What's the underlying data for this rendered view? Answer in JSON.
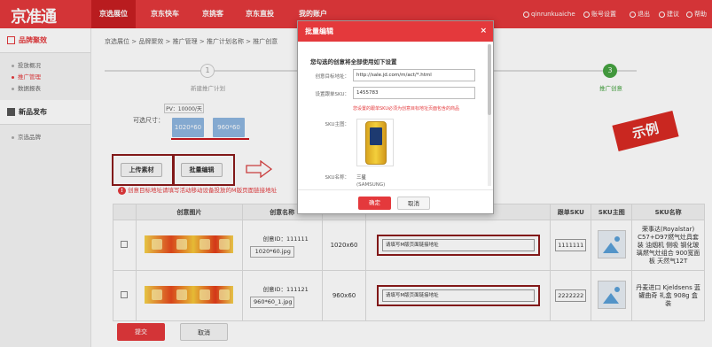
{
  "topnav": {
    "logo": "京准通",
    "tabs": [
      {
        "label": "京选展位",
        "active": true
      },
      {
        "label": "京东快车",
        "active": false
      },
      {
        "label": "京挑客",
        "active": false
      },
      {
        "label": "京东直投",
        "active": false
      },
      {
        "label": "我的账户",
        "active": false
      }
    ],
    "user": "qinrunkuaiche",
    "actions": [
      "账号设置",
      "退出",
      "建议",
      "帮助"
    ]
  },
  "sidebar": {
    "section1": "品牌聚效",
    "items1": [
      {
        "label": "投放概况",
        "active": false
      },
      {
        "label": "推广管理",
        "active": true
      },
      {
        "label": "数据报表",
        "active": false
      }
    ],
    "section2": "新品发布",
    "items2": [
      {
        "label": "京选品牌",
        "active": false
      }
    ]
  },
  "breadcrumb": "京选展位 > 品牌聚效 > 推广管理 > 推广计划名称 > 推广创意",
  "steps": [
    {
      "num": "1",
      "label": "新建推广计划",
      "active": false
    },
    {
      "num": "3",
      "label": "推广创意",
      "active": true
    }
  ],
  "size_selector": {
    "label": "可选尺寸：",
    "tooltip": "PV：10000/天",
    "options": [
      "1020*60",
      "960*60"
    ]
  },
  "buttons": {
    "upload": "上传素材",
    "batch_edit": "批量编辑",
    "submit": "提交",
    "cancel": "取消"
  },
  "warning": "创意目标地址请填写活动移动设备投放的M版页面链接地址",
  "stamp": "示例",
  "table": {
    "headers": [
      "创意图片",
      "创意名称",
      "",
      "",
      "跟单SKU",
      "SKU主图",
      "SKU名称"
    ],
    "rows": [
      {
        "creative_id": "创意ID：111111",
        "creative_name": "1020*60.jpg",
        "size": "1020x60",
        "url_placeholder": "请填写M版页面链接地址",
        "sku": "1111111",
        "sku_name": "荣事达(Royalstar) C57+D97燃气灶具套装 油烟机 侧吸 钢化玻璃燃气灶组合 900宽面板 天然气12T"
      },
      {
        "creative_id": "创意ID：111121",
        "creative_name": "960*60_1.jpg",
        "size": "960x60",
        "url_placeholder": "请填写M版页面链接地址",
        "sku": "2222222",
        "sku_name": "丹麦进口 Kjeldsens 蓝罐曲奇 礼盒 908g 盒装"
      }
    ]
  },
  "modal": {
    "title": "批量编辑",
    "close": "×",
    "intro": "您勾选的创意将全部使用如下设置",
    "url_label": "创意目标地址：",
    "url_value": "http://sale.jd.com/m/act/*.html",
    "sku_label": "设置跟单SKU：",
    "sku_value": "1455783",
    "hint": "您设置的跟单SKU必须为创意目标地址页面包含的商品",
    "image_label": "SKU主图：",
    "name_label": "SKU名称：",
    "name_value_1": "三星",
    "name_value_2": "(SAMSUNG)",
    "ok": "确定",
    "cancel": "取消"
  }
}
